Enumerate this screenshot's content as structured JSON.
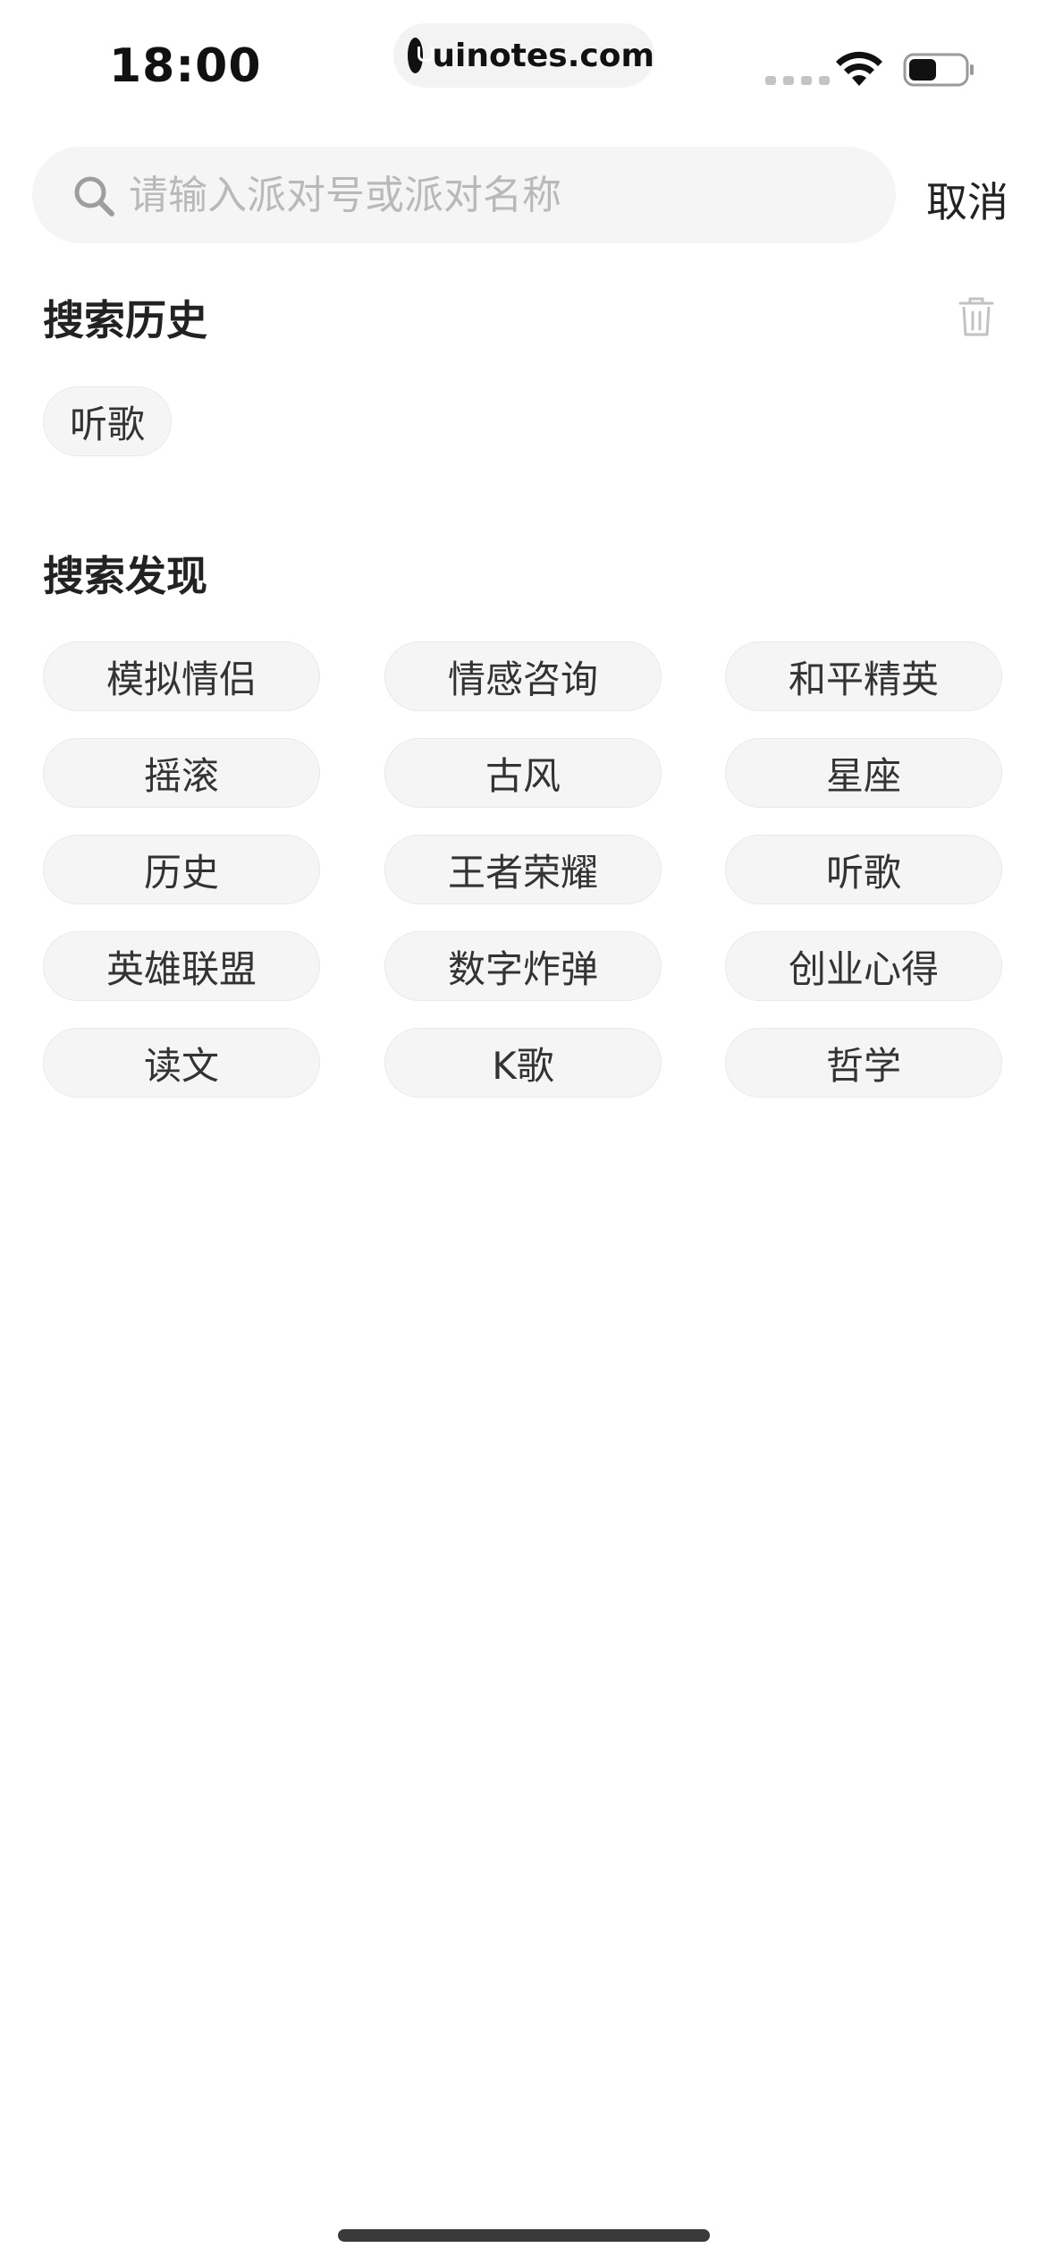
{
  "status_bar": {
    "time": "18:00",
    "url": "uinotes.com",
    "icons": [
      "signal-icon",
      "wifi-icon",
      "battery-icon"
    ]
  },
  "search": {
    "placeholder": "请输入派对号或派对名称",
    "value": "",
    "cancel_label": "取消"
  },
  "history": {
    "title": "搜索历史",
    "items": [
      "听歌"
    ]
  },
  "discover": {
    "title": "搜索发现",
    "items": [
      "模拟情侣",
      "情感咨询",
      "和平精英",
      "摇滚",
      "古风",
      "星座",
      "历史",
      "王者荣耀",
      "听歌",
      "英雄联盟",
      "数字炸弹",
      "创业心得",
      "读文",
      "K歌",
      "哲学"
    ]
  },
  "colors": {
    "chip_background": "#f5f5f5",
    "placeholder": "#b9b9b9",
    "text": "#222222"
  }
}
